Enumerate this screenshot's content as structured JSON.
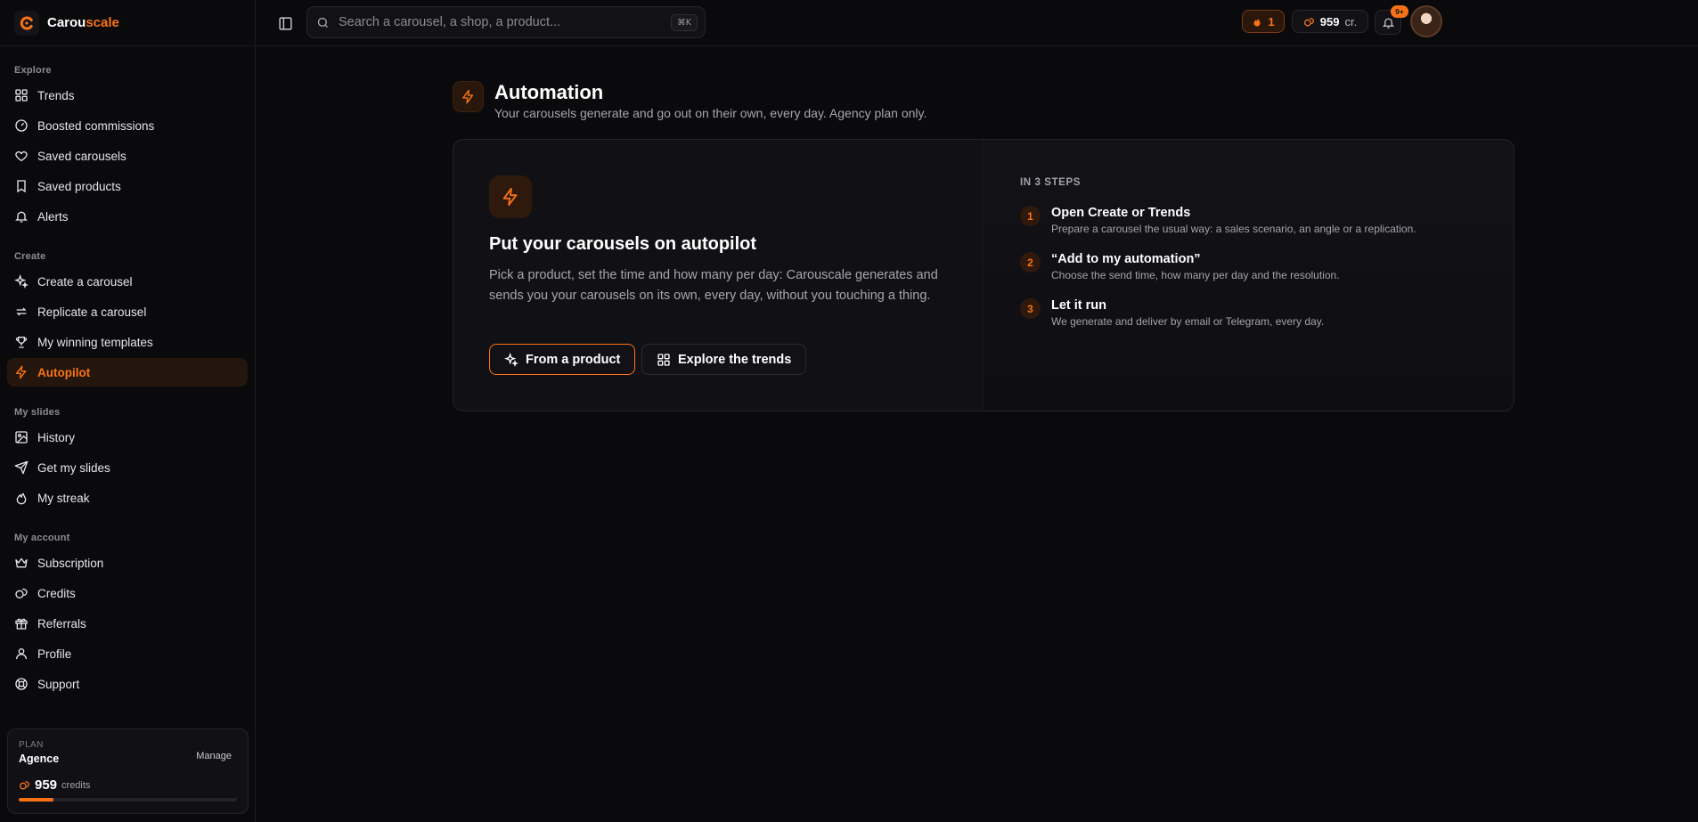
{
  "brand": {
    "name_a": "Carou",
    "name_b": "scale"
  },
  "colors": {
    "accent": "#f97316",
    "background": "#0a0a0d",
    "surface": "#111115"
  },
  "search": {
    "placeholder": "Search a carousel, a shop, a product...",
    "shortcut": "⌘K"
  },
  "topbar": {
    "streak_count": "1",
    "credits_count": "959",
    "credits_unit": "cr.",
    "notifications_badge": "9+"
  },
  "sidebar": {
    "sections": [
      {
        "heading": "Explore",
        "items": [
          {
            "label": "Trends",
            "icon": "grid-icon"
          },
          {
            "label": "Boosted commissions",
            "icon": "gauge-icon"
          },
          {
            "label": "Saved carousels",
            "icon": "heart-icon"
          },
          {
            "label": "Saved products",
            "icon": "bookmark-icon"
          },
          {
            "label": "Alerts",
            "icon": "bell-icon"
          }
        ]
      },
      {
        "heading": "Create",
        "items": [
          {
            "label": "Create a carousel",
            "icon": "sparkles-icon"
          },
          {
            "label": "Replicate a carousel",
            "icon": "repeat-icon"
          },
          {
            "label": "My winning templates",
            "icon": "trophy-icon"
          },
          {
            "label": "Autopilot",
            "icon": "zap-icon",
            "active": true
          }
        ]
      },
      {
        "heading": "My slides",
        "items": [
          {
            "label": "History",
            "icon": "image-icon"
          },
          {
            "label": "Get my slides",
            "icon": "send-icon"
          },
          {
            "label": "My streak",
            "icon": "flame-icon"
          }
        ]
      },
      {
        "heading": "My account",
        "items": [
          {
            "label": "Subscription",
            "icon": "crown-icon"
          },
          {
            "label": "Credits",
            "icon": "coins-icon"
          },
          {
            "label": "Referrals",
            "icon": "gift-icon"
          },
          {
            "label": "Profile",
            "icon": "user-icon"
          },
          {
            "label": "Support",
            "icon": "lifebuoy-icon"
          }
        ]
      }
    ]
  },
  "plan": {
    "label": "PLAN",
    "name": "Agence",
    "manage_label": "Manage",
    "credits": "959",
    "credits_unit": "credits",
    "usage_fraction": 0.16
  },
  "page": {
    "title": "Automation",
    "subtitle": "Your carousels generate and go out on their own, every day. Agency plan only."
  },
  "card": {
    "title": "Put your carousels on autopilot",
    "description": "Pick a product, set the time and how many per day: Carouscale generates and sends you your carousels on its own, every day, without you touching a thing.",
    "primary_button": "From a product",
    "secondary_button": "Explore the trends",
    "steps_heading": "IN 3 STEPS",
    "steps": [
      {
        "num": "1",
        "title": "Open Create or Trends",
        "desc": "Prepare a carousel the usual way: a sales scenario, an angle or a replication."
      },
      {
        "num": "2",
        "title": "“Add to my automation”",
        "desc": "Choose the send time, how many per day and the resolution."
      },
      {
        "num": "3",
        "title": "Let it run",
        "desc": "We generate and deliver by email or Telegram, every day."
      }
    ]
  }
}
